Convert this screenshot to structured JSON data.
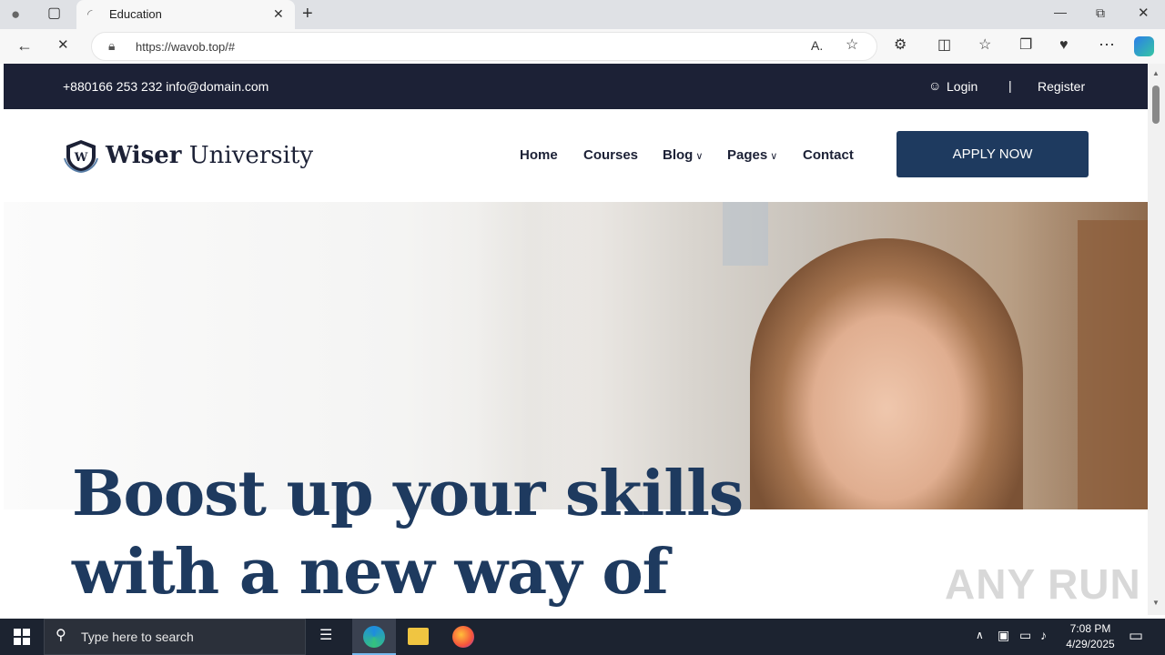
{
  "browser": {
    "tab_title": "Education",
    "url": "https://wavob.top/#"
  },
  "site": {
    "topbar": {
      "contact": "+880166 253 232 info@domain.com",
      "login": "Login",
      "separator": "|",
      "register": "Register"
    },
    "brand": {
      "bold": "Wiser",
      "light": " University",
      "mark": "W"
    },
    "nav": {
      "home": "Home",
      "courses": "Courses",
      "blog": "Blog",
      "pages": "Pages",
      "contact": "Contact",
      "apply": "APPLY NOW"
    },
    "hero": {
      "line1": "Boost up your skills",
      "line2": "with a new way of"
    },
    "watermark": "ANY RUN"
  },
  "taskbar": {
    "search_placeholder": "Type here to search",
    "time": "7:08 PM",
    "date": "4/29/2025"
  },
  "colors": {
    "topbar": "#1c2136",
    "primary": "#1e3a5f"
  }
}
